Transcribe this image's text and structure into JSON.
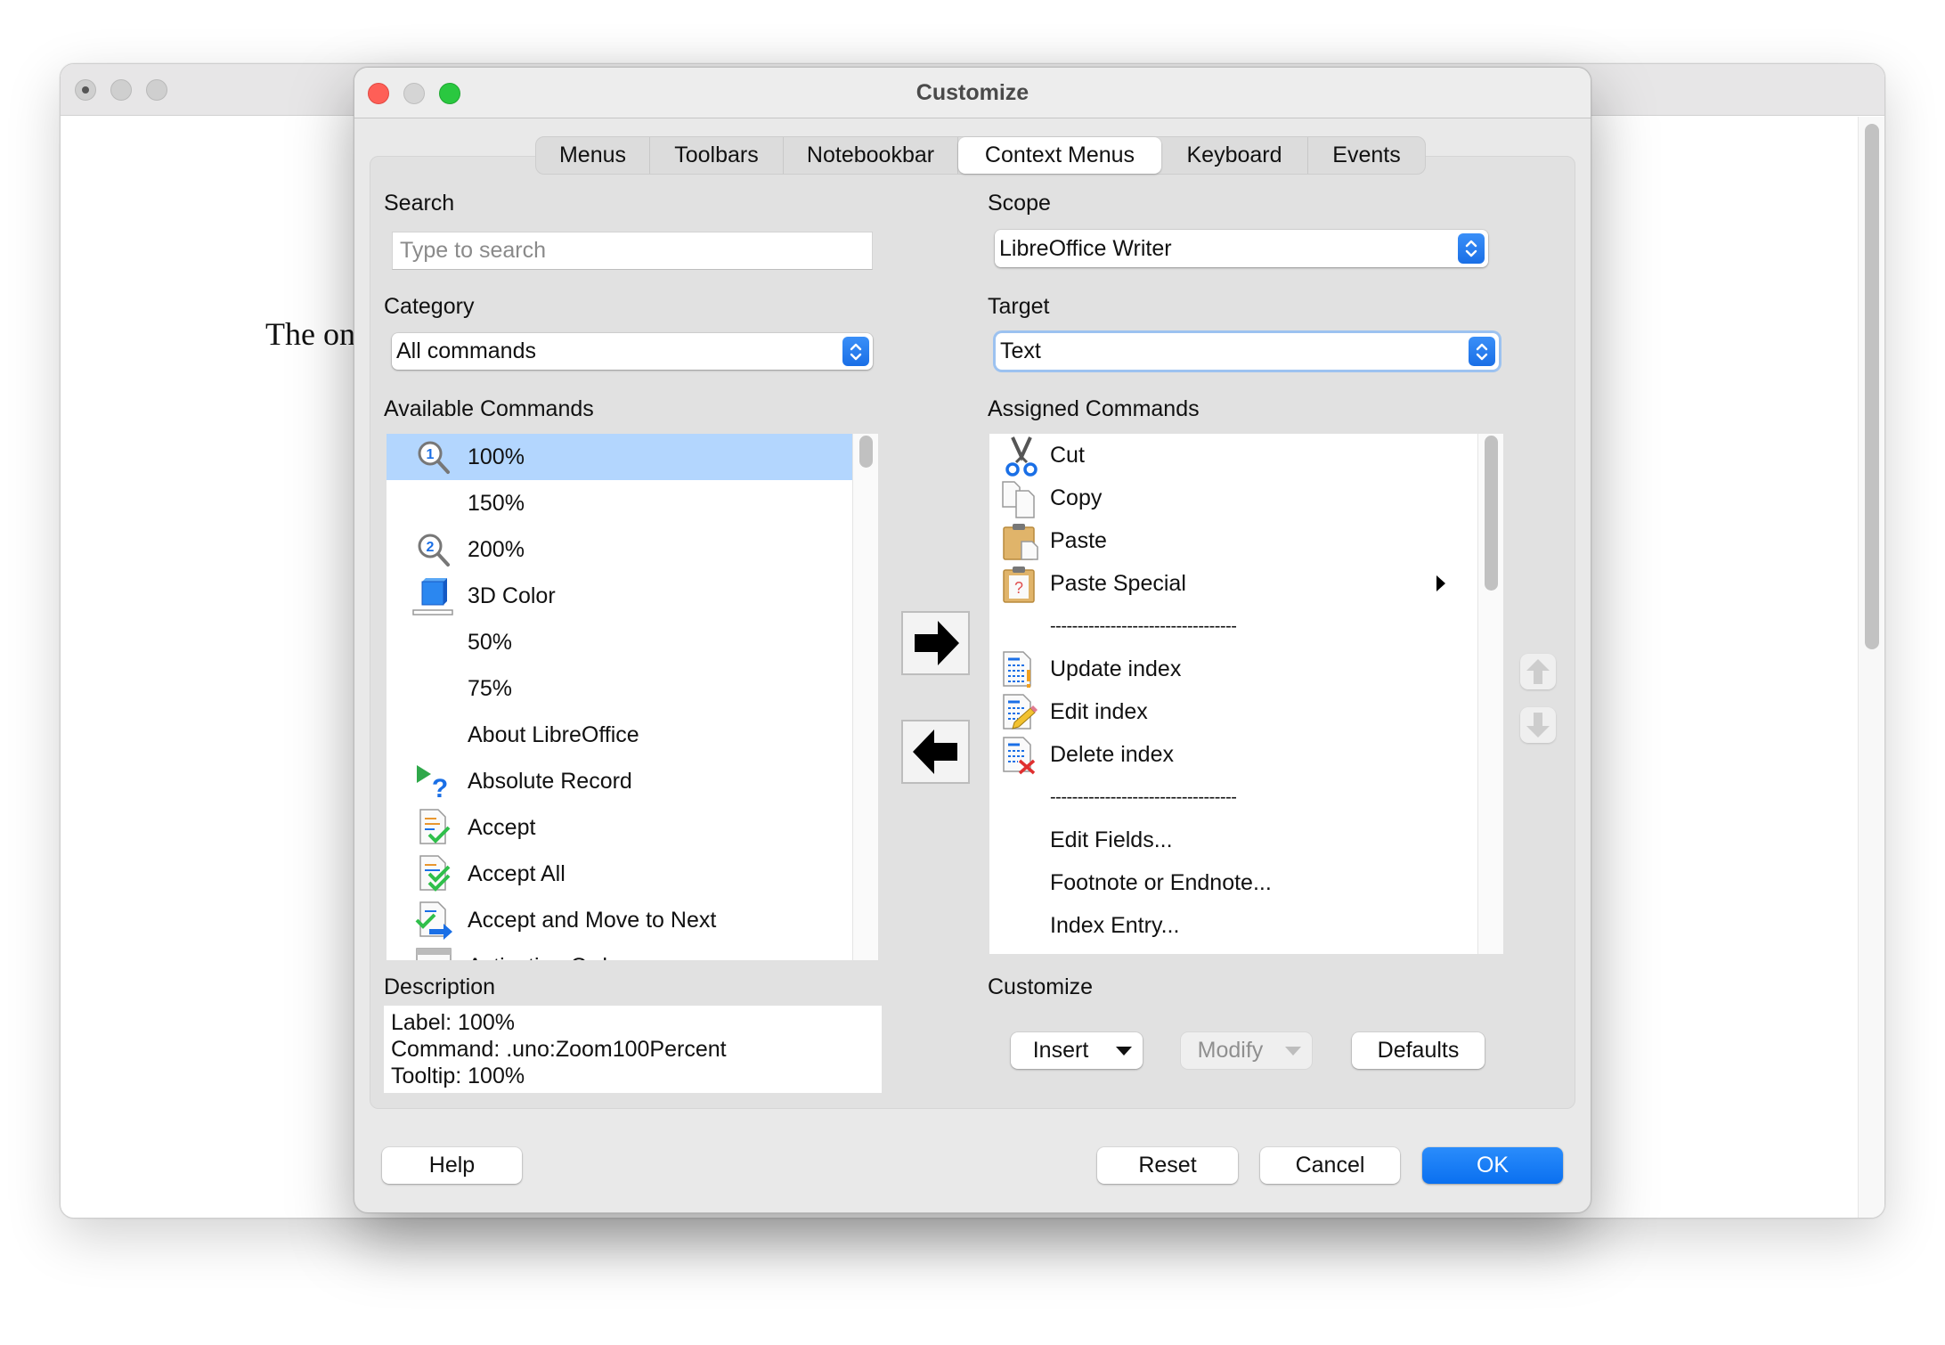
{
  "background_window": {
    "document_text": "The on"
  },
  "dialog": {
    "title": "Customize",
    "tabs": [
      {
        "label": "Menus",
        "active": false
      },
      {
        "label": "Toolbars",
        "active": false
      },
      {
        "label": "Notebookbar",
        "active": false
      },
      {
        "label": "Context Menus",
        "active": true
      },
      {
        "label": "Keyboard",
        "active": false
      },
      {
        "label": "Events",
        "active": false
      }
    ],
    "left": {
      "search_label": "Search",
      "search_placeholder": "Type to search",
      "search_value": "",
      "category_label": "Category",
      "category_value": "All commands",
      "available_label": "Available Commands",
      "available_commands": [
        {
          "label": "100%",
          "icon": "zoom-100-icon",
          "selected": true
        },
        {
          "label": "150%",
          "icon": "",
          "selected": false
        },
        {
          "label": "200%",
          "icon": "zoom-200-icon",
          "selected": false
        },
        {
          "label": "3D Color",
          "icon": "3d-color-icon",
          "selected": false
        },
        {
          "label": "50%",
          "icon": "",
          "selected": false
        },
        {
          "label": "75%",
          "icon": "",
          "selected": false
        },
        {
          "label": "About LibreOffice",
          "icon": "",
          "selected": false
        },
        {
          "label": "Absolute Record",
          "icon": "absolute-record-icon",
          "selected": false
        },
        {
          "label": "Accept",
          "icon": "accept-icon",
          "selected": false
        },
        {
          "label": "Accept All",
          "icon": "accept-all-icon",
          "selected": false
        },
        {
          "label": "Accept and Move to Next",
          "icon": "accept-next-icon",
          "selected": false
        },
        {
          "label": "Activation Order",
          "icon": "activation-order-icon",
          "selected": false
        }
      ],
      "description_label": "Description",
      "description_lines": [
        "Label: 100%",
        "Command: .uno:Zoom100Percent",
        "Tooltip: 100%"
      ]
    },
    "right": {
      "scope_label": "Scope",
      "scope_value": "LibreOffice Writer",
      "target_label": "Target",
      "target_value": "Text",
      "assigned_label": "Assigned Commands",
      "assigned_commands": [
        {
          "label": "Cut",
          "icon": "cut-icon",
          "submenu": false
        },
        {
          "label": "Copy",
          "icon": "copy-icon",
          "submenu": false
        },
        {
          "label": "Paste",
          "icon": "paste-icon",
          "submenu": false
        },
        {
          "label": "Paste Special",
          "icon": "paste-special-icon",
          "submenu": true
        },
        {
          "label": "----------------------------------",
          "icon": "",
          "submenu": false,
          "separator": true
        },
        {
          "label": "Update index",
          "icon": "update-index-icon",
          "submenu": false
        },
        {
          "label": "Edit index",
          "icon": "edit-index-icon",
          "submenu": false
        },
        {
          "label": "Delete index",
          "icon": "delete-index-icon",
          "submenu": false
        },
        {
          "label": "----------------------------------",
          "icon": "",
          "submenu": false,
          "separator": true
        },
        {
          "label": "Edit Fields...",
          "icon": "",
          "submenu": false
        },
        {
          "label": "Footnote or Endnote...",
          "icon": "",
          "submenu": false
        },
        {
          "label": "Index Entry...",
          "icon": "",
          "submenu": false
        }
      ],
      "customize_label": "Customize",
      "insert_label": "Insert",
      "modify_label": "Modify",
      "defaults_label": "Defaults"
    },
    "footer": {
      "help_label": "Help",
      "reset_label": "Reset",
      "cancel_label": "Cancel",
      "ok_label": "OK"
    },
    "colors": {
      "accent": "#0a70f0",
      "selection": "#b3d6fe"
    }
  }
}
